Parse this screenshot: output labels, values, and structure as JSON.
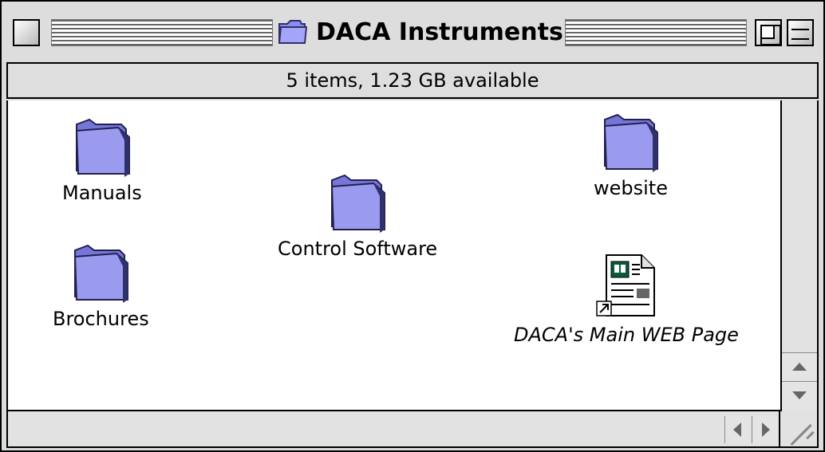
{
  "window": {
    "title": "DACA Instruments",
    "info": "5 items, 1.23 GB available"
  },
  "items": [
    {
      "label": "Manuals",
      "icon": "folder-icon"
    },
    {
      "label": "Control Software",
      "icon": "folder-icon"
    },
    {
      "label": "website",
      "icon": "folder-icon"
    },
    {
      "label": "Brochures",
      "icon": "folder-icon"
    },
    {
      "label": "DACA's Main  WEB Page",
      "icon": "web-document-alias-icon"
    }
  ],
  "colors": {
    "folder": "#8c8cf0",
    "folder_shadow": "#30306a"
  }
}
